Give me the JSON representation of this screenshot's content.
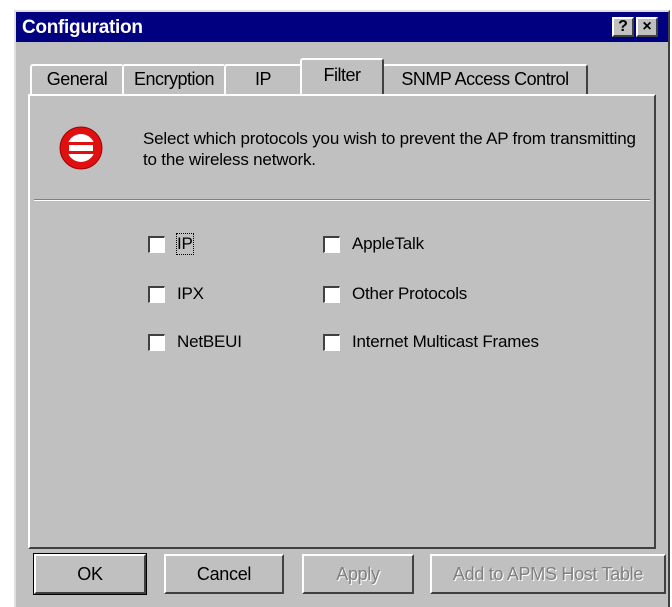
{
  "window": {
    "title": "Configuration",
    "help_button": "?",
    "close_button": "×"
  },
  "tabs": [
    {
      "label": "General",
      "active": false
    },
    {
      "label": "Encryption",
      "active": false
    },
    {
      "label": "IP",
      "active": false
    },
    {
      "label": "Filter",
      "active": true
    },
    {
      "label": "SNMP Access Control",
      "active": false
    }
  ],
  "filter": {
    "icon": "no-entry-icon",
    "description": "Select which protocols you wish to prevent the AP from transmitting to the wireless network.",
    "protocols": [
      {
        "label": "IP",
        "checked": false
      },
      {
        "label": "IPX",
        "checked": false
      },
      {
        "label": "NetBEUI",
        "checked": false
      },
      {
        "label": "AppleTalk",
        "checked": false
      },
      {
        "label": "Other Protocols",
        "checked": false
      },
      {
        "label": "Internet Multicast Frames",
        "checked": false
      }
    ]
  },
  "buttons": {
    "ok": "OK",
    "cancel": "Cancel",
    "apply": "Apply",
    "add_host": "Add to APMS Host Table"
  },
  "colors": {
    "titlebar": "#000080",
    "face": "#c0c0c0",
    "icon_red": "#e01010"
  }
}
